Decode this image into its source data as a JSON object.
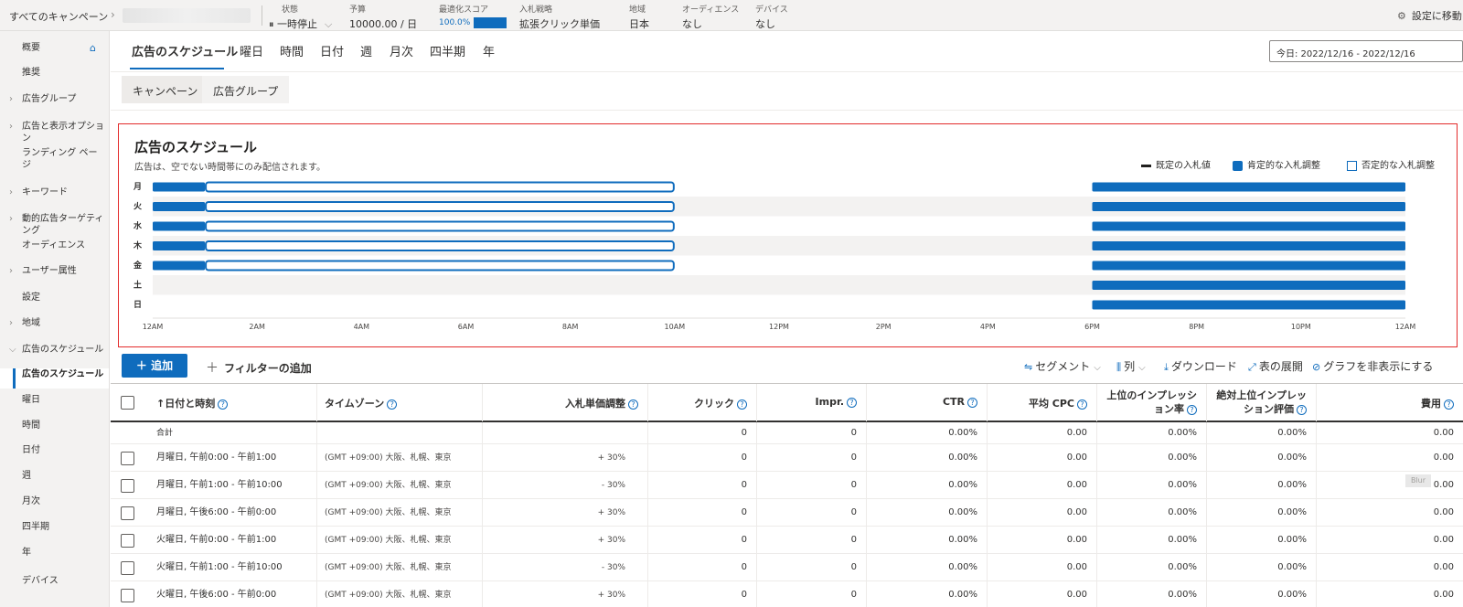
{
  "topbar": {
    "breadcrumb": "すべてのキャンペーン",
    "status": {
      "label": "状態",
      "value": "一時停止"
    },
    "budget": {
      "label": "予算",
      "value": "10000.00 / 日"
    },
    "score": {
      "label": "最適化スコア",
      "value": "100.0%",
      "fraction": 1.0
    },
    "bid": {
      "label": "入札戦略",
      "value": "拡張クリック単価"
    },
    "region": {
      "label": "地域",
      "value": "日本"
    },
    "audience": {
      "label": "オーディエンス",
      "value": "なし"
    },
    "device": {
      "label": "デバイス",
      "value": "なし"
    },
    "settings": "設定に移動"
  },
  "sidebar": {
    "items": [
      {
        "label": "概要",
        "expandable": false
      },
      {
        "label": "推奨",
        "expandable": false
      },
      {
        "label": "広告グループ",
        "expandable": true
      },
      {
        "label": "広告と表示オプション",
        "expandable": true
      },
      {
        "label": "ランディング ページ",
        "expandable": false
      },
      {
        "label": "キーワード",
        "expandable": true
      },
      {
        "label": "動的広告ターゲティング",
        "expandable": true
      },
      {
        "label": "オーディエンス",
        "expandable": false
      },
      {
        "label": "ユーザー属性",
        "expandable": true
      },
      {
        "label": "設定",
        "expandable": false
      },
      {
        "label": "地域",
        "expandable": true
      },
      {
        "label": "広告のスケジュール",
        "expandable": true,
        "expanded": true
      },
      {
        "label": "広告のスケジュール",
        "sub": true,
        "active": true
      },
      {
        "label": "曜日",
        "sub": true
      },
      {
        "label": "時間",
        "sub": true
      },
      {
        "label": "日付",
        "sub": true
      },
      {
        "label": "週",
        "sub": true
      },
      {
        "label": "月次",
        "sub": true
      },
      {
        "label": "四半期",
        "sub": true
      },
      {
        "label": "年",
        "sub": true
      },
      {
        "label": "デバイス",
        "expandable": false
      }
    ]
  },
  "tabs": [
    "広告のスケジュール",
    "曜日",
    "時間",
    "日付",
    "週",
    "月次",
    "四半期",
    "年"
  ],
  "date_range": "今日: 2022/12/16 - 2022/12/16",
  "level_tabs": [
    "キャンペーン",
    "広告グループ"
  ],
  "schedule": {
    "title": "広告のスケジュール",
    "subtitle": "広告は、空でない時間帯にのみ配信されます。",
    "legend": [
      "既定の入札値",
      "肯定的な入札調整",
      "否定的な入札調整"
    ],
    "days": [
      "月",
      "火",
      "水",
      "木",
      "金",
      "土",
      "日"
    ],
    "x_ticks": [
      "12AM",
      "2AM",
      "4AM",
      "6AM",
      "8AM",
      "10AM",
      "12PM",
      "2PM",
      "4PM",
      "6PM",
      "8PM",
      "10PM",
      "12AM"
    ],
    "segments": [
      {
        "day": "月",
        "start": 0,
        "end": 1,
        "kind": "positive"
      },
      {
        "day": "月",
        "start": 1,
        "end": 10,
        "kind": "negative"
      },
      {
        "day": "月",
        "start": 18,
        "end": 24,
        "kind": "positive"
      },
      {
        "day": "火",
        "start": 0,
        "end": 1,
        "kind": "positive"
      },
      {
        "day": "火",
        "start": 1,
        "end": 10,
        "kind": "negative"
      },
      {
        "day": "火",
        "start": 18,
        "end": 24,
        "kind": "positive"
      },
      {
        "day": "水",
        "start": 0,
        "end": 1,
        "kind": "positive"
      },
      {
        "day": "水",
        "start": 1,
        "end": 10,
        "kind": "negative"
      },
      {
        "day": "水",
        "start": 18,
        "end": 24,
        "kind": "positive"
      },
      {
        "day": "木",
        "start": 0,
        "end": 1,
        "kind": "positive"
      },
      {
        "day": "木",
        "start": 1,
        "end": 10,
        "kind": "negative"
      },
      {
        "day": "木",
        "start": 18,
        "end": 24,
        "kind": "positive"
      },
      {
        "day": "金",
        "start": 0,
        "end": 1,
        "kind": "positive"
      },
      {
        "day": "金",
        "start": 1,
        "end": 10,
        "kind": "negative"
      },
      {
        "day": "金",
        "start": 18,
        "end": 24,
        "kind": "positive"
      },
      {
        "day": "土",
        "start": 18,
        "end": 24,
        "kind": "positive"
      },
      {
        "day": "日",
        "start": 18,
        "end": 24,
        "kind": "positive"
      }
    ],
    "colors": {
      "accent": "#0f6cbd",
      "band": "#f3f2f1"
    }
  },
  "toolbar": {
    "add": "＋ 追加",
    "filter": "フィルターの追加",
    "segment": "セグメント",
    "columns": "列",
    "download": "ダウンロード",
    "expand": "表の展開",
    "hide_chart": "グラフを非表示にする"
  },
  "table": {
    "columns": [
      "日付と時刻",
      "タイムゾーン",
      "入札単価調整",
      "クリック",
      "Impr.",
      "CTR",
      "平均 CPC",
      "上位のインプレッション率",
      "絶対上位インプレッション評価",
      "費用"
    ],
    "total": {
      "label": "合計",
      "clicks": "0",
      "impr": "0",
      "ctr": "0.00%",
      "cpc": "0.00",
      "top": "0.00%",
      "abs": "0.00%",
      "cost": "0.00"
    },
    "rows": [
      {
        "when": "月曜日, 午前0:00 - 午前1:00",
        "tz": "(GMT +09:00) 大阪、札幌、東京",
        "bid": "+ 30%",
        "clicks": "0",
        "impr": "0",
        "ctr": "0.00%",
        "cpc": "0.00",
        "top": "0.00%",
        "abs": "0.00%",
        "cost": "0.00"
      },
      {
        "when": "月曜日, 午前1:00 - 午前10:00",
        "tz": "(GMT +09:00) 大阪、札幌、東京",
        "bid": "- 30%",
        "clicks": "0",
        "impr": "0",
        "ctr": "0.00%",
        "cpc": "0.00",
        "top": "0.00%",
        "abs": "0.00%",
        "cost": "0.00"
      },
      {
        "when": "月曜日, 午後6:00 - 午前0:00",
        "tz": "(GMT +09:00) 大阪、札幌、東京",
        "bid": "+ 30%",
        "clicks": "0",
        "impr": "0",
        "ctr": "0.00%",
        "cpc": "0.00",
        "top": "0.00%",
        "abs": "0.00%",
        "cost": "0.00"
      },
      {
        "when": "火曜日, 午前0:00 - 午前1:00",
        "tz": "(GMT +09:00) 大阪、札幌、東京",
        "bid": "+ 30%",
        "clicks": "0",
        "impr": "0",
        "ctr": "0.00%",
        "cpc": "0.00",
        "top": "0.00%",
        "abs": "0.00%",
        "cost": "0.00"
      },
      {
        "when": "火曜日, 午前1:00 - 午前10:00",
        "tz": "(GMT +09:00) 大阪、札幌、東京",
        "bid": "- 30%",
        "clicks": "0",
        "impr": "0",
        "ctr": "0.00%",
        "cpc": "0.00",
        "top": "0.00%",
        "abs": "0.00%",
        "cost": "0.00"
      },
      {
        "when": "火曜日, 午後6:00 - 午前0:00",
        "tz": "(GMT +09:00) 大阪、札幌、東京",
        "bid": "+ 30%",
        "clicks": "0",
        "impr": "0",
        "ctr": "0.00%",
        "cpc": "0.00",
        "top": "0.00%",
        "abs": "0.00%",
        "cost": "0.00"
      }
    ]
  },
  "blur_tag": "Blur"
}
